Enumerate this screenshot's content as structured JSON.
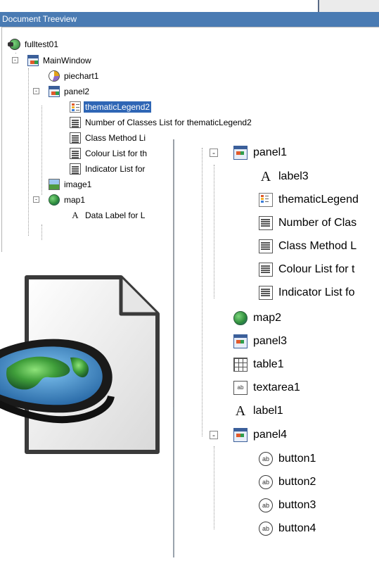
{
  "window": {
    "title": "Document Treeview"
  },
  "tree_top": [
    {
      "label": "fulltest01",
      "icon": "application-root-icon",
      "expander": ""
    },
    {
      "label": "MainWindow",
      "icon": "window-icon",
      "expander": "-"
    },
    {
      "label": "piechart1",
      "icon": "pie-chart-icon",
      "expander": ""
    },
    {
      "label": "panel2",
      "icon": "panel-icon",
      "expander": "-"
    },
    {
      "label": "thematicLegend2",
      "icon": "legend-icon",
      "expander": "",
      "selected": true
    },
    {
      "label": "Number of Classes List for thematicLegend2",
      "icon": "list-icon",
      "expander": ""
    },
    {
      "label": "Class Method Li",
      "icon": "list-icon",
      "expander": ""
    },
    {
      "label": "Colour List for th",
      "icon": "list-icon",
      "expander": ""
    },
    {
      "label": "Indicator List for",
      "icon": "list-icon",
      "expander": ""
    },
    {
      "label": "image1",
      "icon": "image-icon",
      "expander": ""
    },
    {
      "label": "map1",
      "icon": "globe-icon",
      "expander": "-"
    },
    {
      "label": "Data Label for L",
      "icon": "data-label-icon",
      "expander": ""
    }
  ],
  "tree_zoom": [
    {
      "label": "panel1",
      "icon": "panel-icon",
      "expander": "-"
    },
    {
      "label": "label3",
      "icon": "label-edit-icon",
      "expander": ""
    },
    {
      "label": "thematicLegend",
      "icon": "legend-icon",
      "expander": ""
    },
    {
      "label": "Number of Clas",
      "icon": "list-icon",
      "expander": ""
    },
    {
      "label": "Class Method L",
      "icon": "list-icon",
      "expander": ""
    },
    {
      "label": "Colour List for t",
      "icon": "list-icon",
      "expander": ""
    },
    {
      "label": "Indicator List fo",
      "icon": "list-icon",
      "expander": ""
    },
    {
      "label": "map2",
      "icon": "globe-icon",
      "expander": ""
    },
    {
      "label": "panel3",
      "icon": "panel-icon",
      "expander": ""
    },
    {
      "label": "table1",
      "icon": "table-icon",
      "expander": ""
    },
    {
      "label": "textarea1",
      "icon": "textarea-icon",
      "expander": ""
    },
    {
      "label": "label1",
      "icon": "label-icon",
      "expander": ""
    },
    {
      "label": "panel4",
      "icon": "panel-icon",
      "expander": "-"
    },
    {
      "label": "button1",
      "icon": "button-icon",
      "expander": ""
    },
    {
      "label": "button2",
      "icon": "button-icon",
      "expander": ""
    },
    {
      "label": "button3",
      "icon": "button-icon",
      "expander": ""
    },
    {
      "label": "button4",
      "icon": "button-icon",
      "expander": ""
    }
  ],
  "icon_glyphs": {
    "button": "ab",
    "textarea": "ab",
    "label": "A"
  },
  "colors": {
    "title_bar": "#4a7bb3",
    "selection": "#2f66b5"
  },
  "app_icon": {
    "icon": "document-globe-mouse-icon"
  }
}
